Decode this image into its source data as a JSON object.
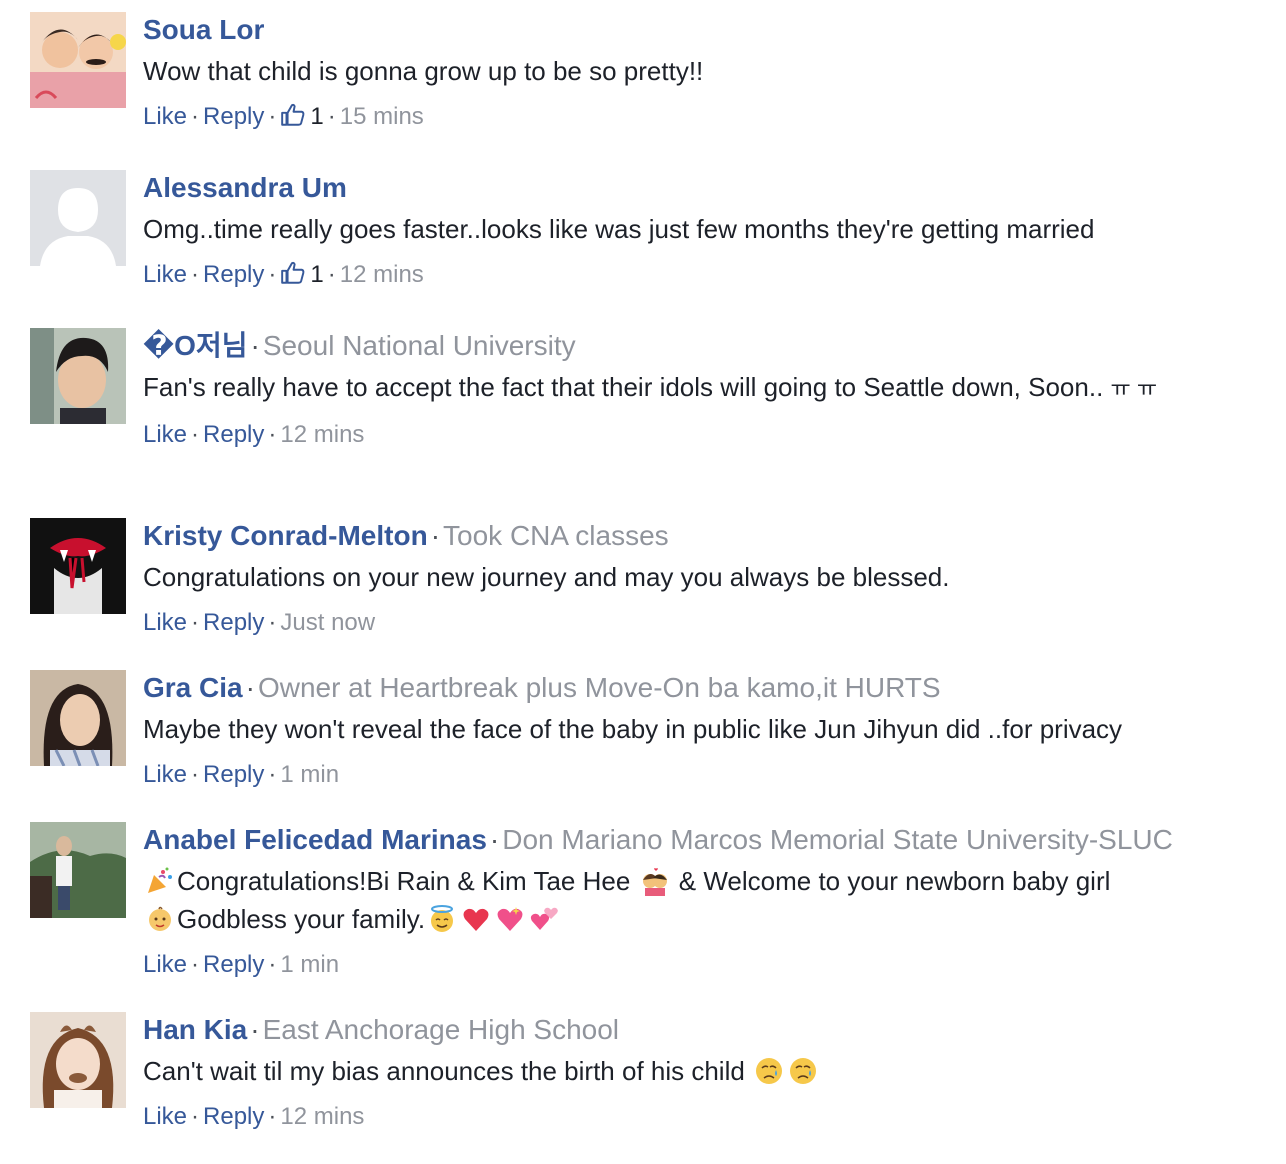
{
  "actions": {
    "like": "Like",
    "reply": "Reply"
  },
  "comments": [
    {
      "author": "Soua Lor",
      "text": "Wow that child is gonna grow up to be so pretty!!",
      "likes": "1",
      "time": "15 mins"
    },
    {
      "author": "Alessandra Um",
      "text": "Omg..time really goes faster..looks like was just few months they're getting married",
      "likes": "1",
      "time": "12 mins"
    },
    {
      "author": "�O저님",
      "meta": "Seoul National University",
      "text": "Fan's really have to accept the fact that their idols will going to Seattle down, Soon..",
      "text_tail": "ㅠ ㅠ",
      "time": "12 mins"
    },
    {
      "author": "Kristy Conrad-Melton",
      "meta": "Took CNA classes",
      "text": "Congratulations on your new journey and may you always be blessed.",
      "time": "Just now"
    },
    {
      "author": "Gra Cia",
      "meta": "Owner at Heartbreak plus Move-On ba kamo,it HURTS",
      "text": "Maybe they won't reveal the face of the baby in public like Jun Jihyun did ..for privacy",
      "time": "1 min"
    },
    {
      "author": "Anabel Felicedad Marinas",
      "meta": "Don Mariano Marcos Memorial State University-SLUC",
      "text_a": "Congratulations!Bi Rain & Kim Tae Hee",
      "text_b": "& Welcome to your newborn baby girl",
      "text_c": "Godbless your family.",
      "time": "1 min"
    },
    {
      "author": "Han Kia",
      "meta": "East Anchorage High School",
      "text": "Can't wait til my bias announces the birth of his child",
      "time": "12 mins"
    }
  ],
  "colors": {
    "link": "#365899",
    "meta": "#90949c",
    "text": "#1d2129"
  }
}
